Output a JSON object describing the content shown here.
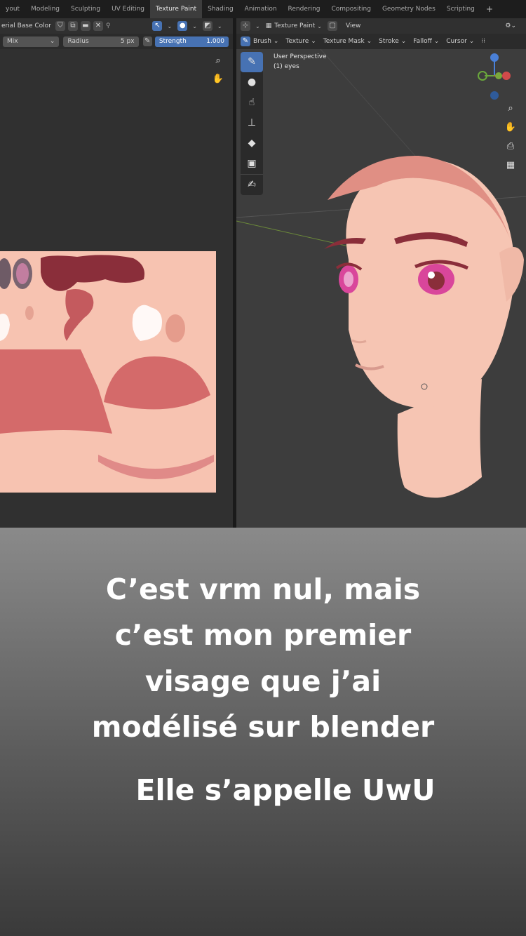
{
  "workspace_tabs": [
    "yout",
    "Modeling",
    "Sculpting",
    "UV Editing",
    "Texture Paint",
    "Shading",
    "Animation",
    "Rendering",
    "Compositing",
    "Geometry Nodes",
    "Scripting",
    "+"
  ],
  "active_tab": "Texture Paint",
  "left_header": {
    "material": "erial Base Color",
    "blend_mode": "Mix",
    "radius_label": "Radius",
    "radius_value": "5 px",
    "strength_label": "Strength",
    "strength_value": "1.000"
  },
  "right_header": {
    "mode": "Texture Paint",
    "view_menu": "View",
    "menus": [
      "Brush",
      "Texture",
      "Texture Mask",
      "Stroke",
      "Falloff",
      "Cursor"
    ]
  },
  "viewport": {
    "perspective": "User Perspective",
    "object": "(1) eyes"
  },
  "icons": {
    "zoom": "magnifier-icon",
    "pan": "hand-icon",
    "camera": "camera-icon",
    "grid": "grid-icon",
    "brush": "brush-icon"
  },
  "colors": {
    "skin": "#f6c5b3",
    "hair": "#8a2e3a",
    "blush": "#d46a6a",
    "accent_blue": "#4772b3",
    "eye": "#d9469b"
  },
  "caption": {
    "line1": "C’est vrm nul, mais",
    "line2": "c’est mon premier",
    "line3": "visage que j’ai",
    "line4": "modélisé sur blender",
    "line5": "Elle s’appelle UwU"
  }
}
